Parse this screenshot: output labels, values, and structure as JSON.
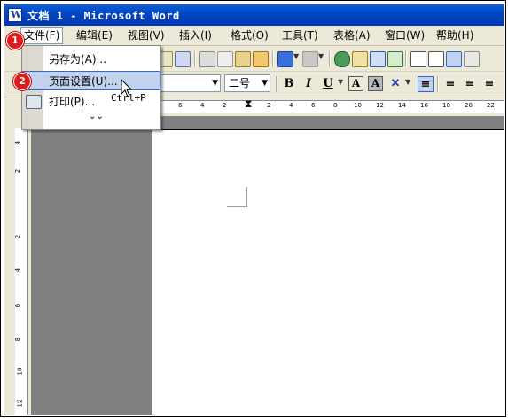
{
  "window": {
    "title": "文档 1 - Microsoft Word"
  },
  "menubar": {
    "items": [
      "文件(F)",
      "编辑(E)",
      "视图(V)",
      "插入(I)",
      "格式(O)",
      "工具(T)",
      "表格(A)",
      "窗口(W)",
      "帮助(H)"
    ]
  },
  "file_menu": {
    "items": [
      {
        "label": "另存为(A)...",
        "shortcut": ""
      },
      {
        "label": "页面设置(U)...",
        "shortcut": ""
      },
      {
        "label": "打印(P)...",
        "shortcut": "Ctrl+P"
      }
    ],
    "expand_label": "⌄⌄"
  },
  "format_toolbar": {
    "font_size": "二号",
    "bold_label": "B",
    "italic_label": "I",
    "underline_label": "U",
    "char_border_label": "A",
    "char_shade_label": "A"
  },
  "badges": {
    "step1": "1",
    "step2": "2"
  },
  "ruler": {
    "horizontal_ticks": [
      "6",
      "4",
      "2",
      "2",
      "4",
      "6",
      "8",
      "10",
      "12",
      "14",
      "16",
      "18",
      "20",
      "22"
    ],
    "vertical_ticks": [
      "4",
      "2",
      "",
      "2",
      "4",
      "6",
      "8",
      "10",
      "12"
    ]
  },
  "colors": {
    "titlebar": "#0347c4",
    "highlight": "#c1d2ee",
    "badge": "#e01b1b"
  }
}
